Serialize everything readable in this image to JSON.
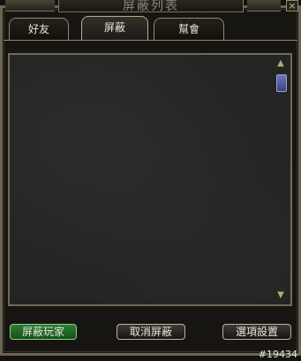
{
  "window": {
    "title": "屏蔽列表",
    "close_label": "×"
  },
  "tabs": [
    {
      "label": "好友",
      "active": false
    },
    {
      "label": "屏蔽",
      "active": true
    },
    {
      "label": "幫會",
      "active": false
    }
  ],
  "list": {
    "scroll_up_icon": "arrow-up-icon",
    "scroll_down_icon": "arrow-down-icon"
  },
  "buttons": {
    "block_player": "屏蔽玩家",
    "unblock": "取消屏蔽",
    "options": "選項設置"
  },
  "footer": {
    "id_label": "#19434"
  },
  "colors": {
    "frame": "#6b6552",
    "accent_green": "#2f7c35",
    "scroll_thumb": "#4a52a0"
  }
}
